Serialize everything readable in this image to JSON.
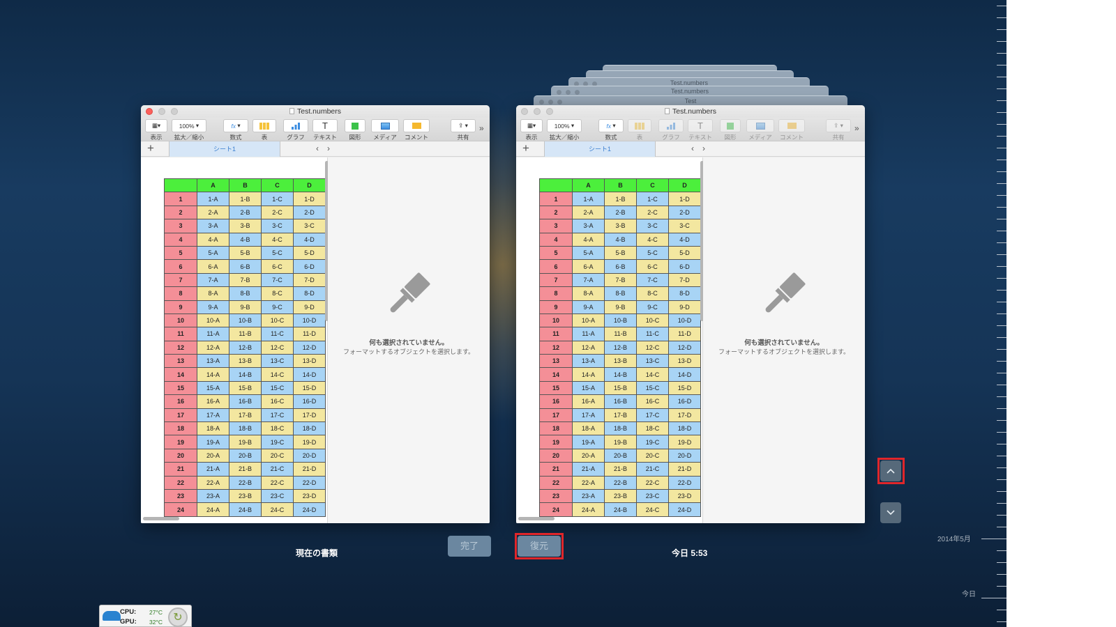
{
  "windows": [
    {
      "id": "current",
      "title": "Test.numbers",
      "toolbar": {
        "zoom": "100%",
        "labels": [
          "表示",
          "拡大／縮小",
          "数式",
          "表",
          "グラフ",
          "テキスト",
          "図形",
          "メディア",
          "コメント",
          "共有"
        ],
        "fx_label": "fx",
        "text_glyph": "T",
        "more": "»"
      },
      "sheet_tab": "シート1",
      "inspector": {
        "message": "何も選択されていません。",
        "sub": "フォーマットするオブジェクトを選択します。"
      }
    },
    {
      "id": "version",
      "title": "Test.numbers",
      "toolbar": {
        "zoom": "100%",
        "labels": [
          "表示",
          "拡大／縮小",
          "数式",
          "表",
          "グラフ",
          "テキスト",
          "図形",
          "メディア",
          "コメント",
          "共有"
        ],
        "fx_label": "fx",
        "text_glyph": "T",
        "more": "»"
      },
      "sheet_tab": "シート1",
      "inspector": {
        "message": "何も選択されていません。",
        "sub": "フォーマットするオブジェクトを選択します。"
      }
    }
  ],
  "stacked_windows": [
    "Test.numbers",
    "Test.numbers",
    "Test"
  ],
  "table": {
    "columns": [
      "A",
      "B",
      "C",
      "D"
    ],
    "rows": [
      [
        "1",
        "1-A",
        "1-B",
        "1-C",
        "1-D"
      ],
      [
        "2",
        "2-A",
        "2-B",
        "2-C",
        "2-D"
      ],
      [
        "3",
        "3-A",
        "3-B",
        "3-C",
        "3-C"
      ],
      [
        "4",
        "4-A",
        "4-B",
        "4-C",
        "4-D"
      ],
      [
        "5",
        "5-A",
        "5-B",
        "5-C",
        "5-D"
      ],
      [
        "6",
        "6-A",
        "6-B",
        "6-C",
        "6-D"
      ],
      [
        "7",
        "7-A",
        "7-B",
        "7-C",
        "7-D"
      ],
      [
        "8",
        "8-A",
        "8-B",
        "8-C",
        "8-D"
      ],
      [
        "9",
        "9-A",
        "9-B",
        "9-C",
        "9-D"
      ],
      [
        "10",
        "10-A",
        "10-B",
        "10-C",
        "10-D"
      ],
      [
        "11",
        "11-A",
        "11-B",
        "11-C",
        "11-D"
      ],
      [
        "12",
        "12-A",
        "12-B",
        "12-C",
        "12-D"
      ],
      [
        "13",
        "13-A",
        "13-B",
        "13-C",
        "13-D"
      ],
      [
        "14",
        "14-A",
        "14-B",
        "14-C",
        "14-D"
      ],
      [
        "15",
        "15-A",
        "15-B",
        "15-C",
        "15-D"
      ],
      [
        "16",
        "16-A",
        "16-B",
        "16-C",
        "16-D"
      ],
      [
        "17",
        "17-A",
        "17-B",
        "17-C",
        "17-D"
      ],
      [
        "18",
        "18-A",
        "18-B",
        "18-C",
        "18-D"
      ],
      [
        "19",
        "19-A",
        "19-B",
        "19-C",
        "19-D"
      ],
      [
        "20",
        "20-A",
        "20-B",
        "20-C",
        "20-D"
      ],
      [
        "21",
        "21-A",
        "21-B",
        "21-C",
        "21-D"
      ],
      [
        "22",
        "22-A",
        "22-B",
        "22-C",
        "22-D"
      ],
      [
        "23",
        "23-A",
        "23-B",
        "23-C",
        "23-D"
      ],
      [
        "24",
        "24-A",
        "24-B",
        "24-C",
        "24-D"
      ]
    ]
  },
  "bottom": {
    "current_label": "現在の書類",
    "done_button": "完了",
    "restore_button": "復元",
    "version_label": "今日 5:53"
  },
  "timeline": {
    "month_label": "2014年5月",
    "today_label": "今日"
  },
  "widget": {
    "cpu_label": "CPU:",
    "cpu_value": "27°C",
    "gpu_label": "GPU:",
    "gpu_value": "32°C"
  },
  "colors": {
    "header_green": "#4cef3c",
    "row_header_pink": "#f48f97",
    "cell_blue": "#a8d4f5",
    "cell_yellow": "#f3e7a0",
    "highlight_red": "#e0262a"
  }
}
